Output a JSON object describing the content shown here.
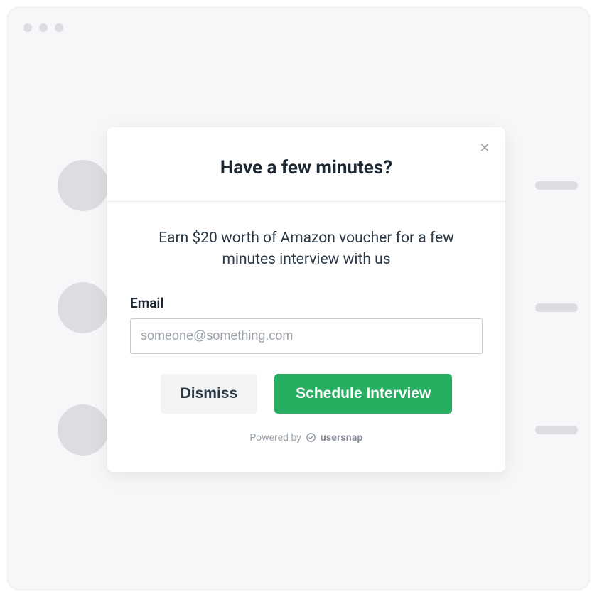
{
  "modal": {
    "title": "Have a few minutes?",
    "description": "Earn $20 worth of Amazon voucher for a few minutes interview with us",
    "email": {
      "label": "Email",
      "placeholder": "someone@something.com",
      "value": ""
    },
    "buttons": {
      "dismiss": "Dismiss",
      "schedule": "Schedule Interview"
    },
    "powered": {
      "prefix": "Powered by",
      "brand": "usersnap"
    }
  },
  "colors": {
    "primary": "#27ae60",
    "text": "#1c2733",
    "muted": "#9aa2aa",
    "border": "#c7ccd1",
    "bg": "#f6f7f8"
  }
}
